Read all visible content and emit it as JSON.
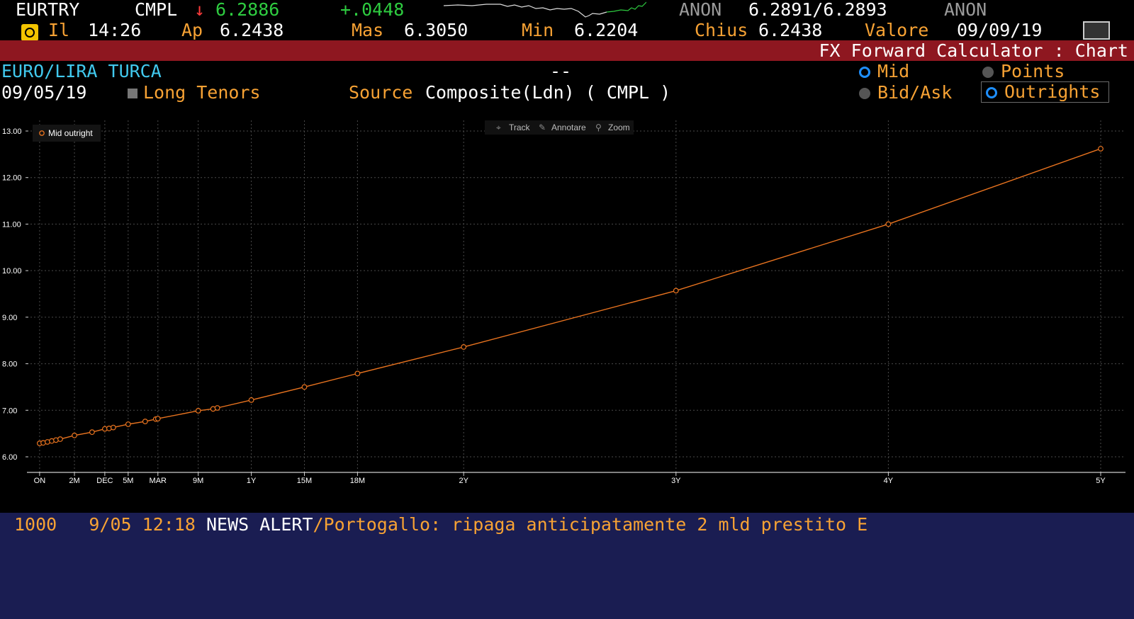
{
  "ticker": {
    "symbol": "EURTRY",
    "source": "CMPL",
    "arrow": "↓",
    "last": "6.2886",
    "change": "+.0448",
    "bid_src": "ANON",
    "bid_ask": "6.2891/6.2893",
    "ask_src": "ANON"
  },
  "stats": {
    "time_label": "Il",
    "time": "14:26",
    "open_label": "Ap",
    "open": "6.2438",
    "high_label": "Mas",
    "high": "6.3050",
    "low_label": "Min",
    "low": "6.2204",
    "close_label": "Chius",
    "close": "6.2438",
    "value_label": "Valore",
    "value_date": "09/09/19"
  },
  "title": "FX Forward Calculator : Chart",
  "header": {
    "pair_name": "EURO/LIRA TURCA",
    "dash": "--",
    "date": "09/05/19",
    "long_tenors": "Long Tenors",
    "source_label": "Source",
    "source_value": "Composite(Ldn) ( CMPL )"
  },
  "options": {
    "mid": "Mid",
    "points": "Points",
    "bid_ask": "Bid/Ask",
    "outrights": "Outrights"
  },
  "toolbar": {
    "track": "Track",
    "annotate": "Annotare",
    "zoom": "Zoom"
  },
  "colors": {
    "series": "#e8731f",
    "grid": "#4a4a4a",
    "accent_green": "#2ecc40",
    "accent_amber": "#f7a234",
    "title_bar": "#8e1720",
    "news_bg": "#1a1d52"
  },
  "chart_data": {
    "type": "line",
    "series": [
      {
        "name": "Mid outright",
        "points": [
          [
            0.003,
            6.29
          ],
          [
            0.02,
            6.3
          ],
          [
            0.04,
            6.32
          ],
          [
            0.06,
            6.34
          ],
          [
            0.08,
            6.36
          ],
          [
            0.1,
            6.38
          ],
          [
            0.167,
            6.46
          ],
          [
            0.25,
            6.53
          ],
          [
            0.31,
            6.6
          ],
          [
            0.33,
            6.61
          ],
          [
            0.35,
            6.63
          ],
          [
            0.42,
            6.7
          ],
          [
            0.5,
            6.76
          ],
          [
            0.55,
            6.81
          ],
          [
            0.56,
            6.82
          ],
          [
            0.75,
            6.99
          ],
          [
            0.82,
            7.03
          ],
          [
            0.84,
            7.05
          ],
          [
            1.0,
            7.22
          ],
          [
            1.25,
            7.5
          ],
          [
            1.5,
            7.79
          ],
          [
            2.0,
            8.36
          ],
          [
            3.0,
            9.57
          ],
          [
            4.0,
            11.0
          ],
          [
            5.0,
            12.62
          ]
        ]
      }
    ],
    "x_ticks": [
      {
        "v": 0.003,
        "label": "ON"
      },
      {
        "v": 0.167,
        "label": "2M"
      },
      {
        "v": 0.31,
        "label": "DEC"
      },
      {
        "v": 0.42,
        "label": "5M"
      },
      {
        "v": 0.56,
        "label": "MAR"
      },
      {
        "v": 0.75,
        "label": "9M"
      },
      {
        "v": 1.0,
        "label": "1Y"
      },
      {
        "v": 1.25,
        "label": "15M"
      },
      {
        "v": 1.5,
        "label": "18M"
      },
      {
        "v": 2.0,
        "label": "2Y"
      },
      {
        "v": 3.0,
        "label": "3Y"
      },
      {
        "v": 4.0,
        "label": "4Y"
      },
      {
        "v": 5.0,
        "label": "5Y"
      }
    ],
    "y_ticks": [
      "13.00",
      "12.00",
      "11.00",
      "10.00",
      "9.00",
      "8.00",
      "7.00",
      "6.00"
    ],
    "ylim": [
      6.0,
      13.0
    ],
    "grid": true,
    "legend_position": "top-left"
  },
  "news": {
    "code": "1000",
    "date": "9/05",
    "time": "12:18",
    "label": "NEWS ALERT",
    "headline": "/Portogallo: ripaga anticipatamente 2 mld prestito E"
  }
}
